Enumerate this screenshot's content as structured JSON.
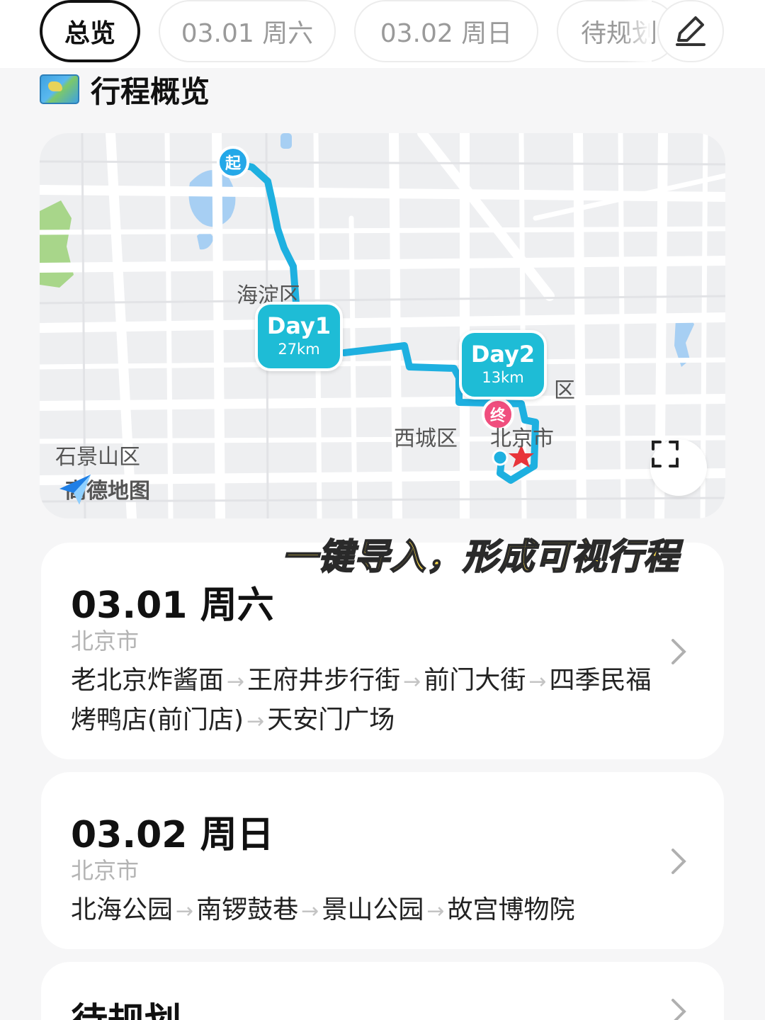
{
  "tabs": [
    {
      "label": "总览",
      "active": true
    },
    {
      "label": "03.01 周六",
      "active": false
    },
    {
      "label": "03.02 周日",
      "active": false
    },
    {
      "label": "待规划",
      "active": false
    }
  ],
  "section": {
    "title": "行程概览",
    "icon": "world-map-icon"
  },
  "map": {
    "provider": "高德地图",
    "labels": {
      "haidian": "海淀区",
      "xicheng": "西城区",
      "shijingshan": "石景山区",
      "beijing": "北京市",
      "dongcheng_partial": "区"
    },
    "day1": {
      "label": "Day1",
      "distance": "27km"
    },
    "day2": {
      "label": "Day2",
      "distance": "13km"
    },
    "start_pin": "起",
    "end_pin": "终",
    "route_color": "#1eb0e0"
  },
  "overlay_caption": "一键导入，形成可视行程",
  "days": [
    {
      "date": "03.01 周六",
      "city": "北京市",
      "route": [
        {
          "text": "老北京炸酱面"
        },
        {
          "text": "王府井步行街"
        },
        {
          "text": "前门大街"
        },
        {
          "text": "四季民福烤鸭店(前门店)"
        },
        {
          "text": "天安门广场"
        }
      ]
    },
    {
      "date": "03.02 周日",
      "city": "北京市",
      "route": [
        {
          "text": "北海公园"
        },
        {
          "text": "南锣鼓巷"
        },
        {
          "text": "景山公园"
        },
        {
          "text": "故宫博物院"
        }
      ]
    },
    {
      "date": "待规划"
    }
  ],
  "route_arrow": "→"
}
